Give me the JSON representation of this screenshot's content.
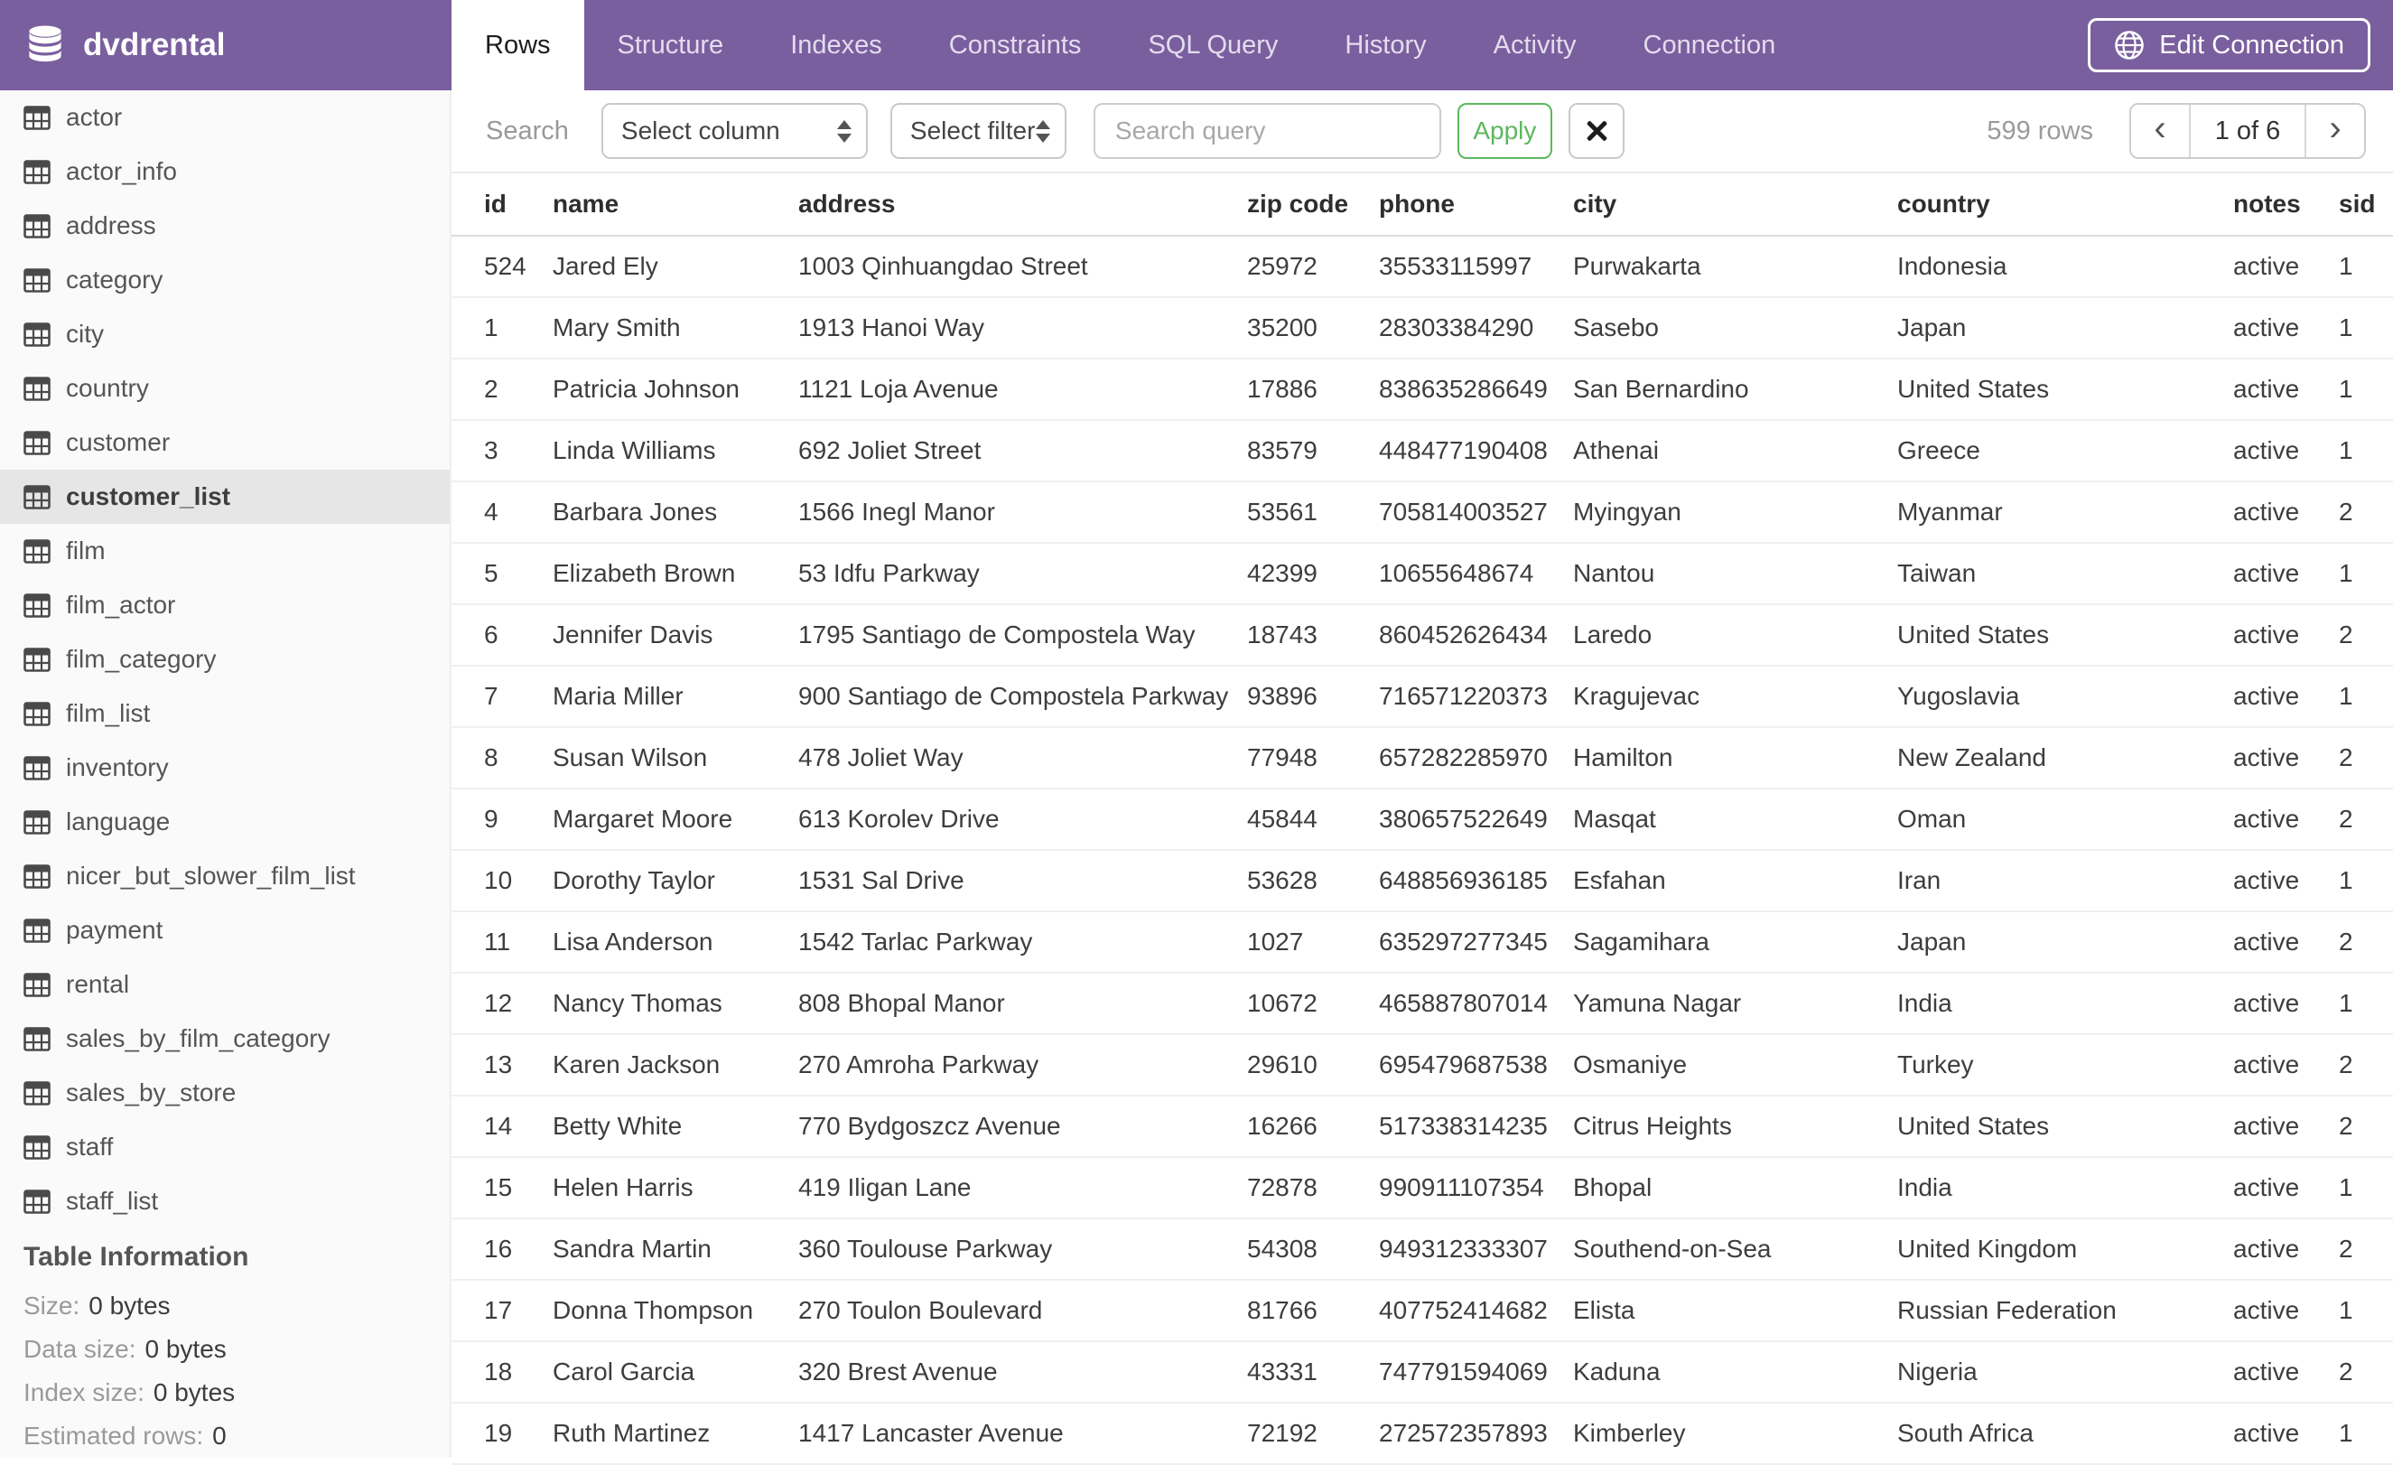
{
  "app": {
    "database_name": "dvdrental"
  },
  "header": {
    "tabs": [
      "Rows",
      "Structure",
      "Indexes",
      "Constraints",
      "SQL Query",
      "History",
      "Activity",
      "Connection"
    ],
    "active_tab": "Rows",
    "edit_connection_label": "Edit Connection"
  },
  "toolbar": {
    "search_label": "Search",
    "column_select_value": "Select column",
    "filter_select_value": "Select filter",
    "query_placeholder": "Search query",
    "query_value": "",
    "apply_label": "Apply",
    "rows_count": "599 rows",
    "pagination": {
      "prev_icon": "‹",
      "current": "1 of 6",
      "next_icon": "›"
    }
  },
  "sidebar": {
    "tables": [
      "actor",
      "actor_info",
      "address",
      "category",
      "city",
      "country",
      "customer",
      "customer_list",
      "film",
      "film_actor",
      "film_category",
      "film_list",
      "inventory",
      "language",
      "nicer_but_slower_film_list",
      "payment",
      "rental",
      "sales_by_film_category",
      "sales_by_store",
      "staff",
      "staff_list"
    ],
    "selected_table": "customer_list",
    "table_information": {
      "title": "Table Information",
      "items": [
        {
          "label": "Size:",
          "value": "0 bytes"
        },
        {
          "label": "Data size:",
          "value": "0 bytes"
        },
        {
          "label": "Index size:",
          "value": "0 bytes"
        },
        {
          "label": "Estimated rows:",
          "value": "0"
        }
      ]
    }
  },
  "grid": {
    "columns": [
      "id",
      "name",
      "address",
      "zip code",
      "phone",
      "city",
      "country",
      "notes",
      "sid"
    ],
    "rows": [
      [
        "524",
        "Jared Ely",
        "1003 Qinhuangdao Street",
        "25972",
        "35533115997",
        "Purwakarta",
        "Indonesia",
        "active",
        "1"
      ],
      [
        "1",
        "Mary Smith",
        "1913 Hanoi Way",
        "35200",
        "28303384290",
        "Sasebo",
        "Japan",
        "active",
        "1"
      ],
      [
        "2",
        "Patricia Johnson",
        "1121 Loja Avenue",
        "17886",
        "838635286649",
        "San Bernardino",
        "United States",
        "active",
        "1"
      ],
      [
        "3",
        "Linda Williams",
        "692 Joliet Street",
        "83579",
        "448477190408",
        "Athenai",
        "Greece",
        "active",
        "1"
      ],
      [
        "4",
        "Barbara Jones",
        "1566 Inegl Manor",
        "53561",
        "705814003527",
        "Myingyan",
        "Myanmar",
        "active",
        "2"
      ],
      [
        "5",
        "Elizabeth Brown",
        "53 Idfu Parkway",
        "42399",
        "10655648674",
        "Nantou",
        "Taiwan",
        "active",
        "1"
      ],
      [
        "6",
        "Jennifer Davis",
        "1795 Santiago de Compostela Way",
        "18743",
        "860452626434",
        "Laredo",
        "United States",
        "active",
        "2"
      ],
      [
        "7",
        "Maria Miller",
        "900 Santiago de Compostela Parkway",
        "93896",
        "716571220373",
        "Kragujevac",
        "Yugoslavia",
        "active",
        "1"
      ],
      [
        "8",
        "Susan Wilson",
        "478 Joliet Way",
        "77948",
        "657282285970",
        "Hamilton",
        "New Zealand",
        "active",
        "2"
      ],
      [
        "9",
        "Margaret Moore",
        "613 Korolev Drive",
        "45844",
        "380657522649",
        "Masqat",
        "Oman",
        "active",
        "2"
      ],
      [
        "10",
        "Dorothy Taylor",
        "1531 Sal Drive",
        "53628",
        "648856936185",
        "Esfahan",
        "Iran",
        "active",
        "1"
      ],
      [
        "11",
        "Lisa Anderson",
        "1542 Tarlac Parkway",
        "1027",
        "635297277345",
        "Sagamihara",
        "Japan",
        "active",
        "2"
      ],
      [
        "12",
        "Nancy Thomas",
        "808 Bhopal Manor",
        "10672",
        "465887807014",
        "Yamuna Nagar",
        "India",
        "active",
        "1"
      ],
      [
        "13",
        "Karen Jackson",
        "270 Amroha Parkway",
        "29610",
        "695479687538",
        "Osmaniye",
        "Turkey",
        "active",
        "2"
      ],
      [
        "14",
        "Betty White",
        "770 Bydgoszcz Avenue",
        "16266",
        "517338314235",
        "Citrus Heights",
        "United States",
        "active",
        "2"
      ],
      [
        "15",
        "Helen Harris",
        "419 Iligan Lane",
        "72878",
        "990911107354",
        "Bhopal",
        "India",
        "active",
        "1"
      ],
      [
        "16",
        "Sandra Martin",
        "360 Toulouse Parkway",
        "54308",
        "949312333307",
        "Southend-on-Sea",
        "United Kingdom",
        "active",
        "2"
      ],
      [
        "17",
        "Donna Thompson",
        "270 Toulon Boulevard",
        "81766",
        "407752414682",
        "Elista",
        "Russian Federation",
        "active",
        "1"
      ],
      [
        "18",
        "Carol Garcia",
        "320 Brest Avenue",
        "43331",
        "747791594069",
        "Kaduna",
        "Nigeria",
        "active",
        "2"
      ],
      [
        "19",
        "Ruth Martinez",
        "1417 Lancaster Avenue",
        "72192",
        "272572357893",
        "Kimberley",
        "South Africa",
        "active",
        "1"
      ]
    ]
  },
  "icons": {
    "logo": "database-icon",
    "edit_connection": "globe-icon",
    "sidebar_item": "table-icon",
    "select_control": "up-down-stepper-icon",
    "clear_search": "x-icon",
    "pagination_prev": "chevron-left-icon",
    "pagination_next": "chevron-right-icon"
  },
  "colors": {
    "topbar_purple": "#7A5F9E",
    "apply_green": "#5CB85C",
    "sidebar_selected_gray": "#E6E6E6",
    "muted_text": "#999999",
    "body_text": "#3D3D3D"
  }
}
